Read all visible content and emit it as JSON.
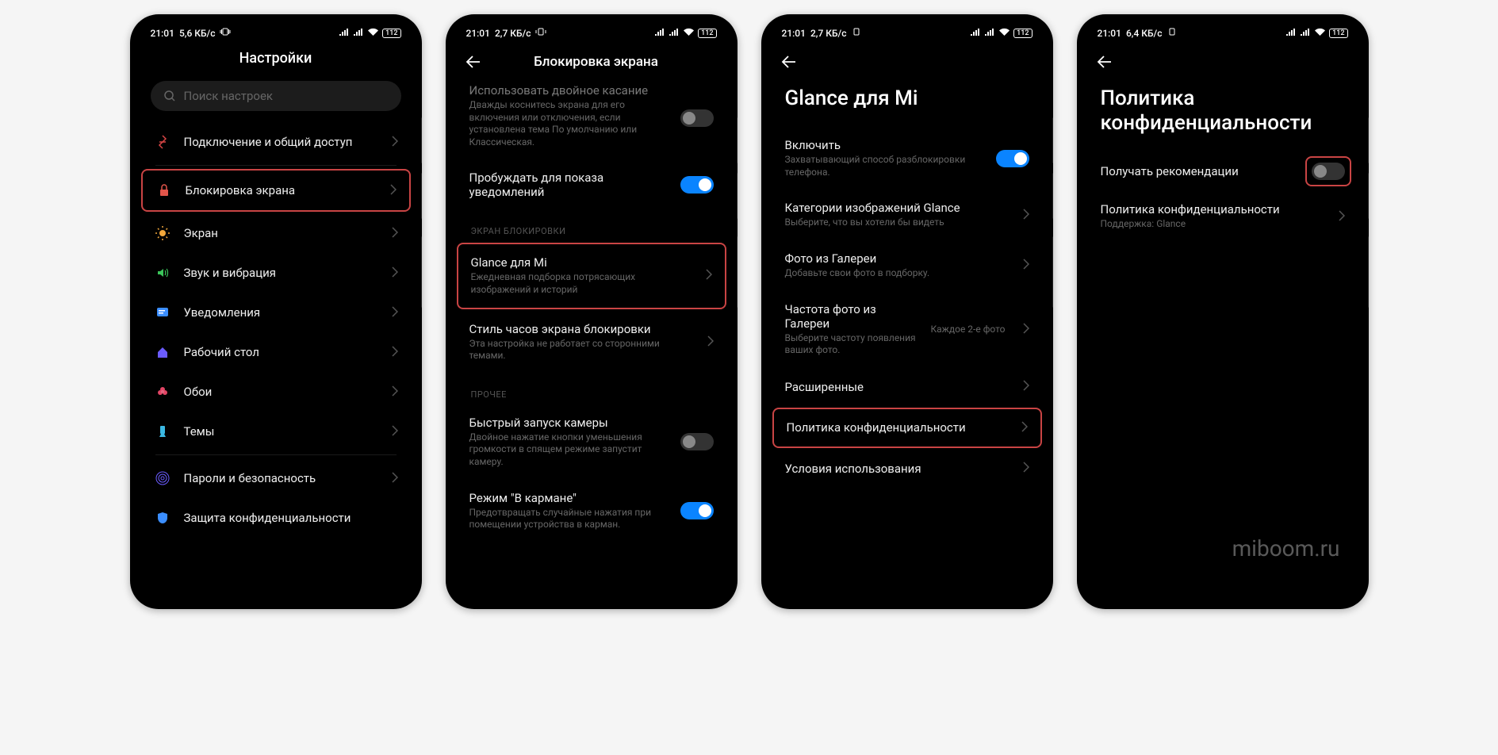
{
  "status": {
    "time": "21:01",
    "speed1": "5,6 КБ/с",
    "speed2": "2,7 КБ/с",
    "speed3": "2,7 КБ/с",
    "speed4": "6,4 КБ/с",
    "battery": "112"
  },
  "screen1": {
    "title": "Настройки",
    "search_placeholder": "Поиск настроек",
    "items": [
      {
        "label": "Подключение и общий доступ"
      },
      {
        "label": "Блокировка экрана"
      },
      {
        "label": "Экран"
      },
      {
        "label": "Звук и вибрация"
      },
      {
        "label": "Уведомления"
      },
      {
        "label": "Рабочий стол"
      },
      {
        "label": "Обои"
      },
      {
        "label": "Темы"
      },
      {
        "label": "Пароли и безопасность"
      },
      {
        "label": "Защита конфиденциальности"
      }
    ]
  },
  "screen2": {
    "title": "Блокировка экрана",
    "item0_title": "Использовать двойное касание",
    "item0_sub": "Дважды коснитесь экрана для его включения или отключения, если установлена тема По умолчанию или Классическая.",
    "item1_title": "Пробуждать для показа уведомлений",
    "section1": "ЭКРАН БЛОКИРОВКИ",
    "item2_title": "Glance для Mi",
    "item2_sub": "Ежедневная подборка потрясающих изображений и историй",
    "item3_title": "Стиль часов экрана блокировки",
    "item3_sub": "Эта настройка не работает со сторонними темами.",
    "section2": "ПРОЧЕЕ",
    "item4_title": "Быстрый запуск камеры",
    "item4_sub": "Двойное нажатие кнопки уменьшения громкости в спящем режиме запустит камеру.",
    "item5_title": "Режим \"В кармане\"",
    "item5_sub": "Предотвращать случайные нажатия при помещении устройства в карман."
  },
  "screen3": {
    "title": "Glance для Mi",
    "item0_title": "Включить",
    "item0_sub": "Захватывающий способ разблокировки телефона.",
    "item1_title": "Категории изображений Glance",
    "item1_sub": "Выберите, что вы хотели бы видеть",
    "item2_title": "Фото из Галереи",
    "item2_sub": "Добавьте свои фото в подборку.",
    "item3_title": "Частота фото из Галереи",
    "item3_value": "Каждое 2-е фото",
    "item3_sub": "Выберите частоту появления ваших фото.",
    "item4_title": "Расширенные",
    "item5_title": "Политика конфиденциальности",
    "item6_title": "Условия использования"
  },
  "screen4": {
    "title": "Политика конфиденциальности",
    "item0_title": "Получать рекомендации",
    "item1_title": "Политика конфиденциальности",
    "item1_sub": "Поддержка: Glance"
  },
  "watermark": "miboom.ru"
}
